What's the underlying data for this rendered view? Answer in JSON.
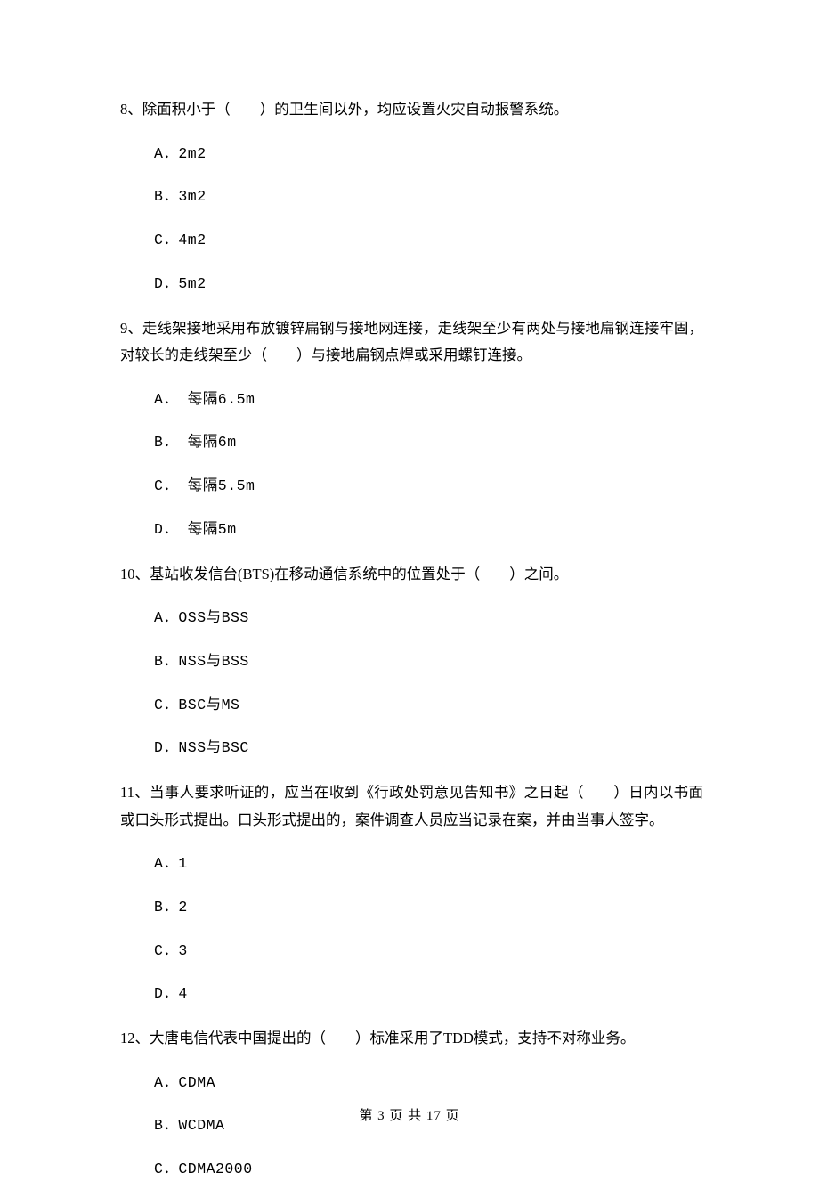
{
  "questions": [
    {
      "number": "8、",
      "text": "除面积小于（　　）的卫生间以外，均应设置火灾自动报警系统。",
      "options": [
        "A．2m2",
        "B．3m2",
        "C．4m2",
        "D．5m2"
      ]
    },
    {
      "number": "9、",
      "text": "走线架接地采用布放镀锌扁钢与接地网连接，走线架至少有两处与接地扁钢连接牢固，对较长的走线架至少（　　）与接地扁钢点焊或采用螺钉连接。",
      "options": [
        "A． 每隔6.5m",
        "B． 每隔6m",
        "C． 每隔5.5m",
        "D． 每隔5m"
      ]
    },
    {
      "number": "10、",
      "text": "基站收发信台(BTS)在移动通信系统中的位置处于（　　）之间。",
      "options": [
        "A．OSS与BSS",
        "B．NSS与BSS",
        "C．BSC与MS",
        "D．NSS与BSC"
      ]
    },
    {
      "number": "11、",
      "text": "当事人要求听证的，应当在收到《行政处罚意见告知书》之日起（　　）日内以书面或口头形式提出。口头形式提出的，案件调查人员应当记录在案，并由当事人签字。",
      "options": [
        "A．1",
        "B．2",
        "C．3",
        "D．4"
      ]
    },
    {
      "number": "12、",
      "text": "大唐电信代表中国提出的（　　）标准采用了TDD模式，支持不对称业务。",
      "options": [
        "A．CDMA",
        "B．WCDMA",
        "C．CDMA2000"
      ]
    }
  ],
  "footer": "第 3 页 共 17 页"
}
